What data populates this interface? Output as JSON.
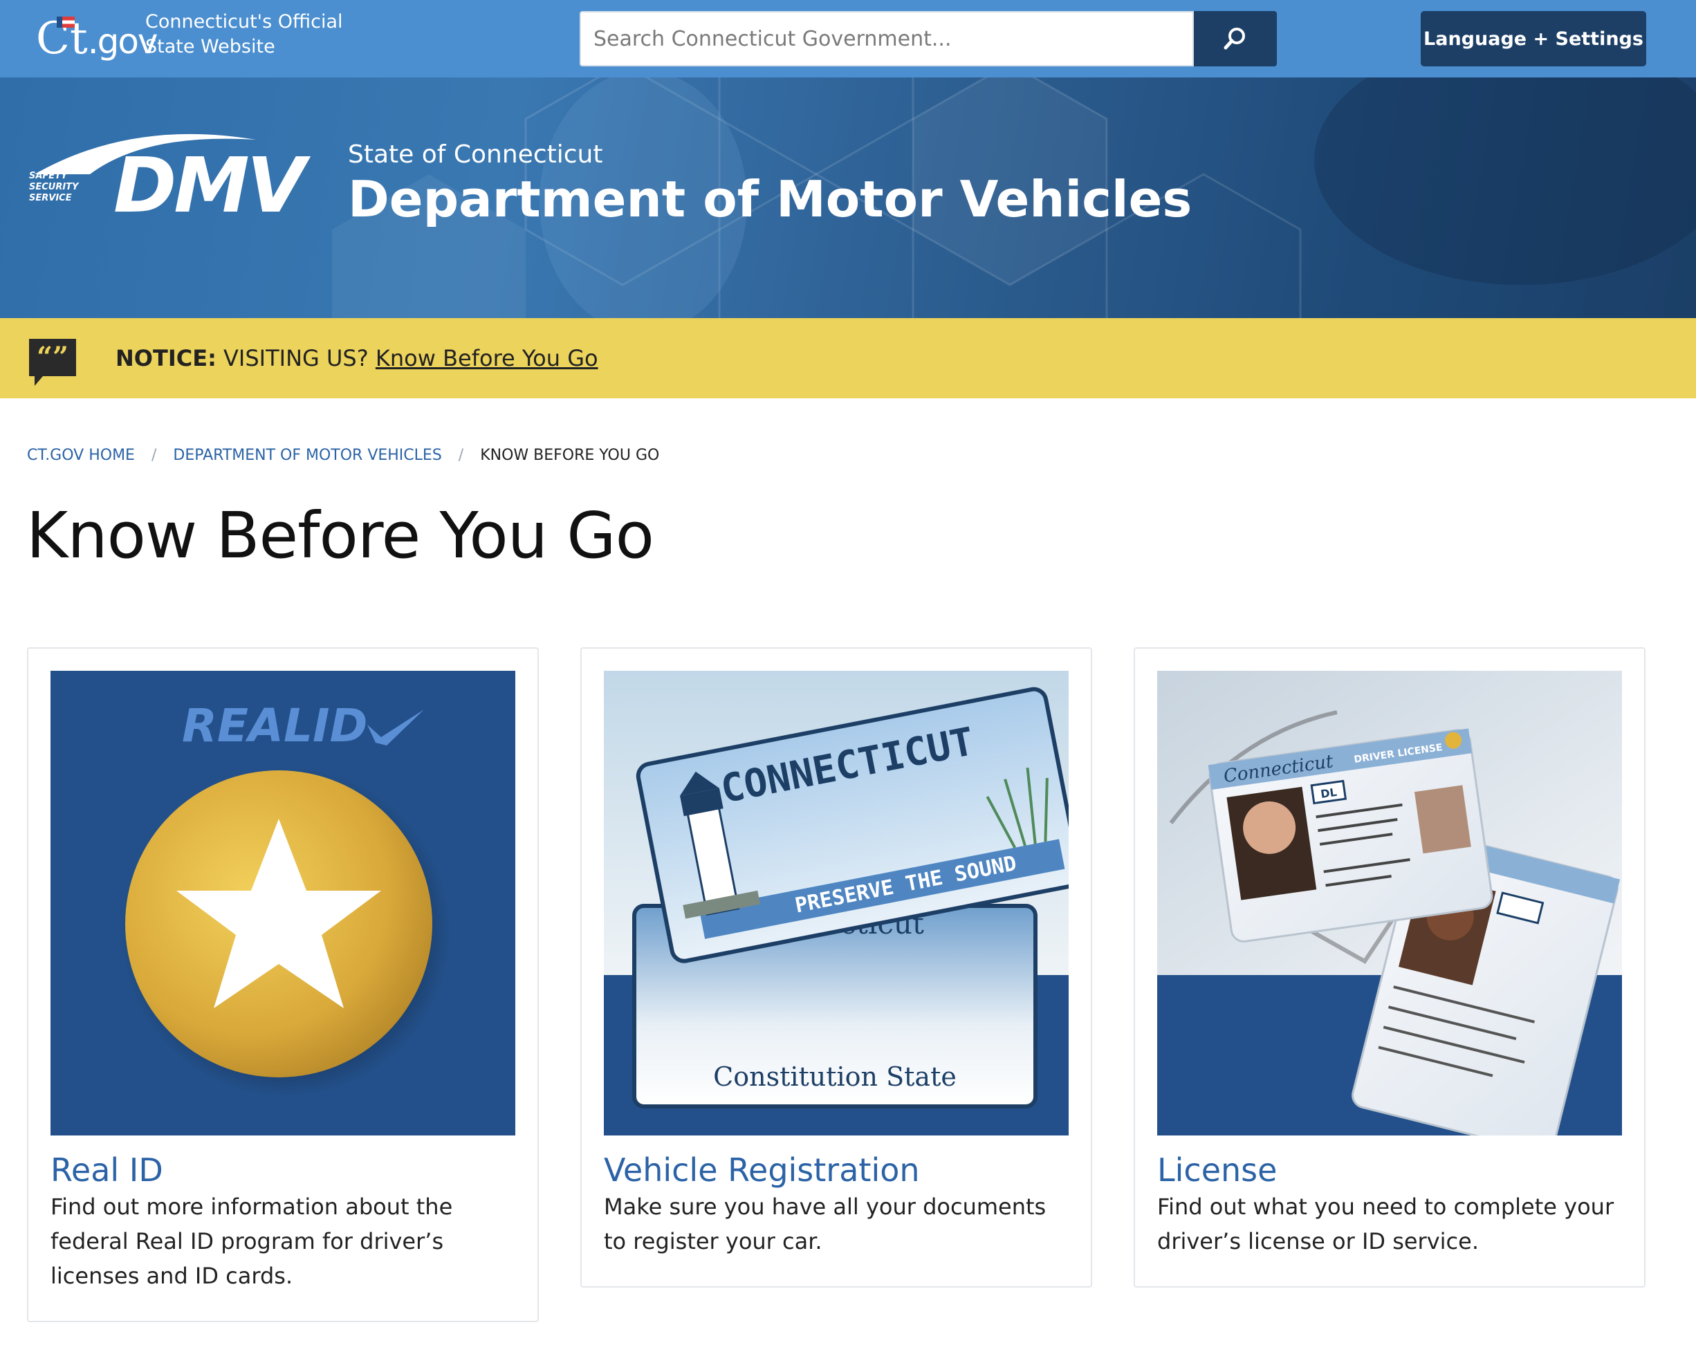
{
  "topbar": {
    "logo_text": "Ct",
    "logo_suffix": ".gov",
    "official_line1": "Connecticut's Official",
    "official_line2": "State Website",
    "search_placeholder": "Search Connecticut Government...",
    "language_button": "Language + Settings"
  },
  "banner": {
    "logo_tag_line1": "SAFETY",
    "logo_tag_line2": "SECURITY",
    "logo_tag_line3": "SERVICE",
    "logo_text": "DMV",
    "state_label": "State of Connecticut",
    "department_title": "Department of Motor Vehicles"
  },
  "notice": {
    "label": "NOTICE:",
    "text": " VISITING US? ",
    "link": "Know Before You Go"
  },
  "breadcrumb": {
    "items": [
      "CT.GOV HOME",
      "DEPARTMENT OF MOTOR VEHICLES"
    ],
    "separator": "/",
    "current": "KNOW BEFORE YOU GO"
  },
  "page": {
    "title": "Know Before You Go"
  },
  "cards": [
    {
      "title": "Real ID",
      "description": "Find out more information about the federal Real ID program for driver’s licenses and ID cards.",
      "image_text": "REALID"
    },
    {
      "title": "Vehicle Registration",
      "description": "Make sure you have all your documents to register your car.",
      "plate_top": "CONNECTICUT",
      "plate_motto": "PRESERVE THE SOUND",
      "plate2_top": "Connecticut",
      "plate2_bottom": "Constitution State"
    },
    {
      "title": "License",
      "description": "Find out what you need to complete your driver’s license or ID service.",
      "card_state": "Connecticut",
      "card_type": "DRIVER LICENSE",
      "card_class": "DL"
    }
  ],
  "colors": {
    "topbar": "#4b8fd0",
    "navy": "#1d3f66",
    "notice": "#ecd35b",
    "link": "#2b63a6",
    "card_blue": "#23508a",
    "gold": "#e2b43c"
  },
  "icons": {
    "search": "magnifier-icon",
    "notice": "quote-bubble-icon",
    "realid_star": "star-icon"
  }
}
